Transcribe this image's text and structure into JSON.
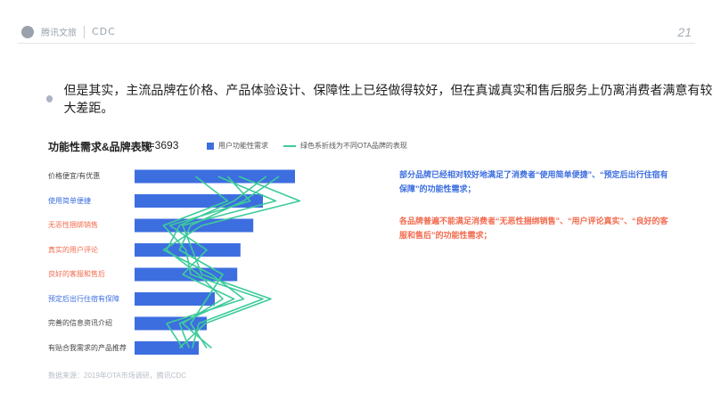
{
  "header": {
    "logo_text": "腾讯文旅",
    "cdc_text": "CDC",
    "page_number": "21"
  },
  "bullet": {
    "text": "但是其实，主流品牌在价格、产品体验设计、保障性上已经做得较好，但在真诚真实和售后服务上仍离消费者满意有较大差距。"
  },
  "chart_header": {
    "title": "功能性需求&品牌表现",
    "n_label": "N=3693"
  },
  "notes": {
    "blue": "部分品牌已经相对较好地满足了消费者“使用简单便捷”、“预定后出行住宿有保障”的功能性需求；",
    "red": "各品牌普遍不能满足消费者“无恶性捆绑销售”、“用户评论真实”、“良好的客服和售后”的功能性需求；"
  },
  "source": "数据来源：2019年OTA市场调研，腾讯CDC",
  "colors": {
    "bar": "#3d6ee0",
    "line": "#3dcb9a",
    "highlight_blue": "#3d6ee0",
    "highlight_red": "#f26b4f",
    "default_label": "#444444"
  },
  "chart_data": {
    "type": "bar",
    "orientation": "horizontal",
    "categories": [
      "价格便宜/有优惠",
      "使用简单便捷",
      "无恶性捆绑销售",
      "真实的用户评论",
      "良好的客服和售后",
      "预定后出行住宿有保障",
      "完善的信息资讯介绍",
      "有贴合我需求的产品推荐"
    ],
    "category_highlight": [
      "default",
      "blue",
      "red",
      "red",
      "red",
      "blue",
      "default",
      "default"
    ],
    "legend": [
      "用户功能性需求",
      "绿色系折线为不同OTA品牌的表现"
    ],
    "series": [
      {
        "name": "用户功能性需求",
        "kind": "bar",
        "values": [
          100,
          80,
          74,
          66,
          64,
          50,
          45,
          40
        ]
      }
    ],
    "brand_lines": [
      [
        38,
        58,
        18,
        32,
        35,
        80,
        40,
        36
      ],
      [
        82,
        62,
        28,
        20,
        40,
        55,
        30,
        48
      ],
      [
        58,
        72,
        22,
        45,
        30,
        62,
        28,
        34
      ],
      [
        65,
        103,
        42,
        18,
        48,
        68,
        20,
        30
      ],
      [
        90,
        68,
        35,
        28,
        55,
        45,
        35,
        45
      ],
      [
        52,
        88,
        30,
        36,
        42,
        85,
        44,
        28
      ]
    ],
    "xlim": [
      0,
      110
    ]
  }
}
